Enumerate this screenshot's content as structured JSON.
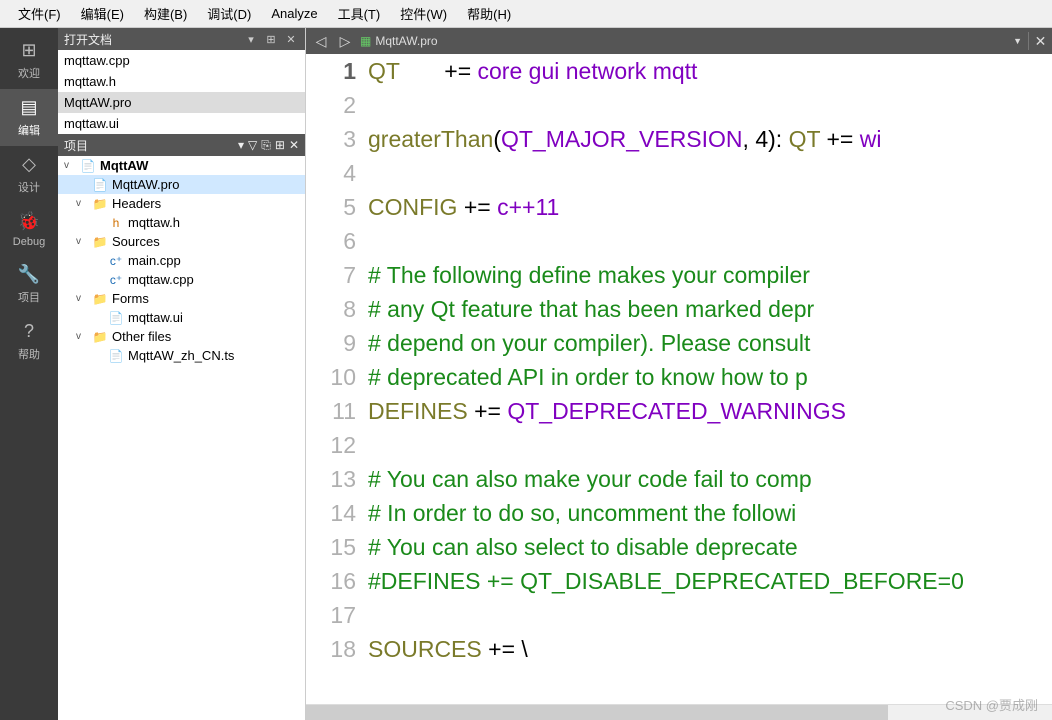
{
  "menubar": [
    {
      "label": "文件(F)"
    },
    {
      "label": "编辑(E)"
    },
    {
      "label": "构建(B)"
    },
    {
      "label": "调试(D)"
    },
    {
      "label": "Analyze"
    },
    {
      "label": "工具(T)"
    },
    {
      "label": "控件(W)"
    },
    {
      "label": "帮助(H)"
    }
  ],
  "modes": [
    {
      "icon": "⊞",
      "label": "欢迎"
    },
    {
      "icon": "▤",
      "label": "编辑"
    },
    {
      "icon": "◇",
      "label": "设计"
    },
    {
      "icon": "🐞",
      "label": "Debug"
    },
    {
      "icon": "🔧",
      "label": "项目"
    },
    {
      "icon": "?",
      "label": "帮助"
    }
  ],
  "openFilesTitle": "打开文档",
  "openFiles": [
    {
      "name": "mqttaw.cpp"
    },
    {
      "name": "mqttaw.h"
    },
    {
      "name": "MqttAW.pro",
      "sel": true
    },
    {
      "name": "mqttaw.ui"
    }
  ],
  "projectTitle": "项目",
  "tree": [
    {
      "depth": 0,
      "exp": "v",
      "icon": "📄",
      "iconCls": "proico",
      "label": "MqttAW",
      "bold": true
    },
    {
      "depth": 1,
      "exp": "",
      "icon": "📄",
      "iconCls": "proico",
      "label": "MqttAW.pro",
      "sel": true
    },
    {
      "depth": 1,
      "exp": "v",
      "icon": "📁",
      "iconCls": "folder",
      "label": "Headers"
    },
    {
      "depth": 2,
      "exp": "",
      "icon": "h",
      "iconCls": "hico",
      "label": "mqttaw.h"
    },
    {
      "depth": 1,
      "exp": "v",
      "icon": "📁",
      "iconCls": "folder",
      "label": "Sources"
    },
    {
      "depth": 2,
      "exp": "",
      "icon": "c⁺",
      "iconCls": "cppico",
      "label": "main.cpp"
    },
    {
      "depth": 2,
      "exp": "",
      "icon": "c⁺",
      "iconCls": "cppico",
      "label": "mqttaw.cpp"
    },
    {
      "depth": 1,
      "exp": "v",
      "icon": "📁",
      "iconCls": "folder",
      "label": "Forms"
    },
    {
      "depth": 2,
      "exp": "",
      "icon": "📄",
      "iconCls": "uiico",
      "label": "mqttaw.ui"
    },
    {
      "depth": 1,
      "exp": "v",
      "icon": "📁",
      "iconCls": "folder",
      "label": "Other files"
    },
    {
      "depth": 2,
      "exp": "",
      "icon": "📄",
      "iconCls": "tsico",
      "label": "MqttAW_zh_CN.ts"
    }
  ],
  "tabFile": "MqttAW.pro",
  "code": {
    "currentLine": 1,
    "lines": [
      [
        {
          "t": "QT",
          "c": "kw"
        },
        {
          "t": "       += ",
          "c": "op"
        },
        {
          "t": "core",
          "c": "lit"
        },
        {
          "t": " ",
          "c": "op"
        },
        {
          "t": "gui",
          "c": "lit"
        },
        {
          "t": " ",
          "c": "op"
        },
        {
          "t": "network",
          "c": "lit"
        },
        {
          "t": " ",
          "c": "op"
        },
        {
          "t": "mqtt",
          "c": "lit"
        }
      ],
      [],
      [
        {
          "t": "greaterThan",
          "c": "kw"
        },
        {
          "t": "(",
          "c": "op"
        },
        {
          "t": "QT_MAJOR_VERSION",
          "c": "lit"
        },
        {
          "t": ", ",
          "c": "op"
        },
        {
          "t": "4",
          "c": "num"
        },
        {
          "t": "): ",
          "c": "op"
        },
        {
          "t": "QT",
          "c": "kw"
        },
        {
          "t": " += ",
          "c": "op"
        },
        {
          "t": "wi",
          "c": "lit"
        }
      ],
      [],
      [
        {
          "t": "CONFIG",
          "c": "kw"
        },
        {
          "t": " += ",
          "c": "op"
        },
        {
          "t": "c++11",
          "c": "lit"
        }
      ],
      [],
      [
        {
          "t": "# The following define makes your compiler",
          "c": "cmt"
        }
      ],
      [
        {
          "t": "# any Qt feature that has been marked depr",
          "c": "cmt"
        }
      ],
      [
        {
          "t": "# depend on your compiler). Please consult",
          "c": "cmt"
        }
      ],
      [
        {
          "t": "# deprecated API in order to know how to p",
          "c": "cmt"
        }
      ],
      [
        {
          "t": "DEFINES",
          "c": "kw"
        },
        {
          "t": " += ",
          "c": "op"
        },
        {
          "t": "QT_DEPRECATED_WARNINGS",
          "c": "lit"
        }
      ],
      [],
      [
        {
          "t": "# You can also make your code fail to comp",
          "c": "cmt"
        }
      ],
      [
        {
          "t": "# In order to do so, uncomment the followi",
          "c": "cmt"
        }
      ],
      [
        {
          "t": "# You can also select to disable deprecate",
          "c": "cmt"
        }
      ],
      [
        {
          "t": "#DEFINES += QT_DISABLE_DEPRECATED_BEFORE=0",
          "c": "cmt"
        }
      ],
      [],
      [
        {
          "t": "SOURCES",
          "c": "kw"
        },
        {
          "t": " += \\",
          "c": "op"
        }
      ]
    ]
  },
  "watermark": "CSDN @贾成刚"
}
